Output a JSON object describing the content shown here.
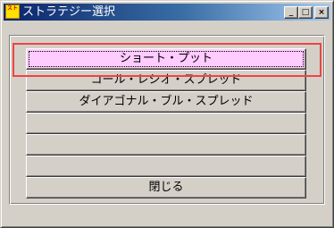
{
  "window": {
    "title": "ストラテジー選択",
    "app_icon_text": "スト"
  },
  "titlebar_buttons": {
    "minimize": "_",
    "maximize": "□",
    "close": "×"
  },
  "buttons": [
    {
      "label": "ショート・プット",
      "selected": true
    },
    {
      "label": "コール・レシオ・スプレッド",
      "selected": false
    },
    {
      "label": "ダイアゴナル・ブル・スプレッド",
      "selected": false
    },
    {
      "label": "",
      "selected": false
    },
    {
      "label": "",
      "selected": false
    },
    {
      "label": "閉じる",
      "selected": false
    }
  ],
  "colors": {
    "selected_button": "#ffccff",
    "highlight_box": "#ee4444",
    "titlebar_start": "#0a246a",
    "titlebar_end": "#a6caf0",
    "face": "#d4d0c8"
  }
}
